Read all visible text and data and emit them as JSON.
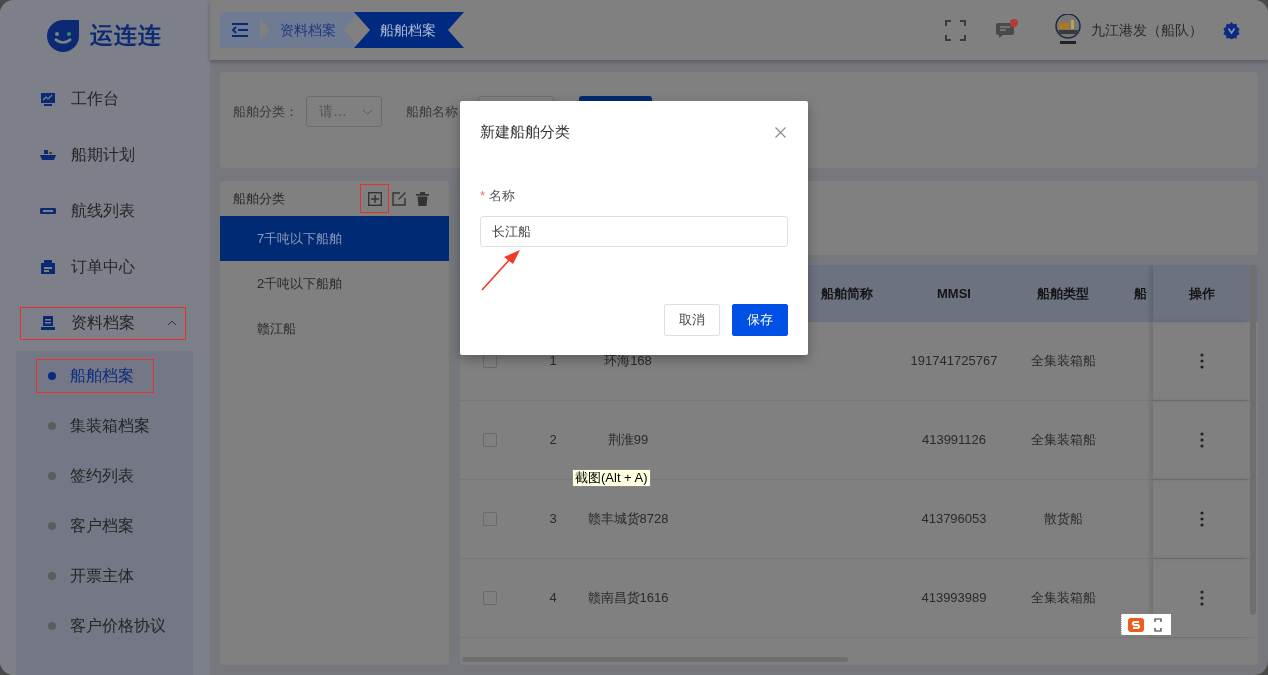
{
  "logo": {
    "name": "运连连"
  },
  "sidebar": {
    "items": [
      {
        "label": "工作台",
        "highlighted": false
      },
      {
        "label": "船期计划",
        "highlighted": false
      },
      {
        "label": "航线列表",
        "highlighted": false
      },
      {
        "label": "订单中心",
        "highlighted": false
      },
      {
        "label": "资料档案",
        "expanded": true,
        "highlighted": true,
        "children": [
          {
            "label": "船舶档案",
            "selected": true,
            "highlighted": true
          },
          {
            "label": "集装箱档案",
            "selected": false,
            "highlighted": false
          },
          {
            "label": "签约列表",
            "selected": false,
            "highlighted": false
          },
          {
            "label": "客户档案",
            "selected": false,
            "highlighted": false
          },
          {
            "label": "开票主体",
            "selected": false,
            "highlighted": false
          },
          {
            "label": "客户价格协议",
            "selected": false,
            "highlighted": false
          }
        ]
      }
    ]
  },
  "topbar": {
    "breadcrumbs": [
      {
        "label": "资料档案",
        "selected": false
      },
      {
        "label": "船舶档案",
        "selected": true
      }
    ],
    "unread": true,
    "user": "九江港发（船队）"
  },
  "filters": [
    {
      "label": "船舶分类：",
      "placeholder": "请…"
    },
    {
      "label": "船舶名称"
    }
  ],
  "category_panel": {
    "title": "船舶分类",
    "actions": [
      {
        "kind": "add",
        "highlighted": true
      },
      {
        "kind": "edit",
        "highlighted": false
      },
      {
        "kind": "delete",
        "highlighted": false
      }
    ],
    "items": [
      {
        "label": "7千吨以下船舶",
        "selected": true
      },
      {
        "label": "2千吨以下船舶",
        "selected": false
      },
      {
        "label": "赣江船",
        "selected": false
      }
    ]
  },
  "table": {
    "columns": [
      "船舶简称",
      "MMSI",
      "船舶类型",
      "船",
      "操作"
    ],
    "rows": [
      {
        "index": "1",
        "name": "环海168",
        "mmsi": "191741725767",
        "type": "全集装箱船",
        "checked": false
      },
      {
        "index": "2",
        "name": "荆淮99",
        "mmsi": "413991126",
        "type": "全集装箱船",
        "checked": false
      },
      {
        "index": "3",
        "name": "赣丰城货8728",
        "mmsi": "413796053",
        "type": "散货船",
        "checked": false
      },
      {
        "index": "4",
        "name": "赣南昌货1616",
        "mmsi": "413993989",
        "type": "全集装箱船",
        "checked": false
      }
    ]
  },
  "dialog": {
    "title": "新建船舶分类",
    "field": {
      "required_mark": "*",
      "label": "名称",
      "value": "长江船",
      "pointer_arrow": true
    },
    "buttons": [
      {
        "label": "取消",
        "kind": "secondary"
      },
      {
        "label": "保存",
        "kind": "primary"
      }
    ]
  },
  "tooltip": {
    "text": "截图(Alt + A)"
  }
}
